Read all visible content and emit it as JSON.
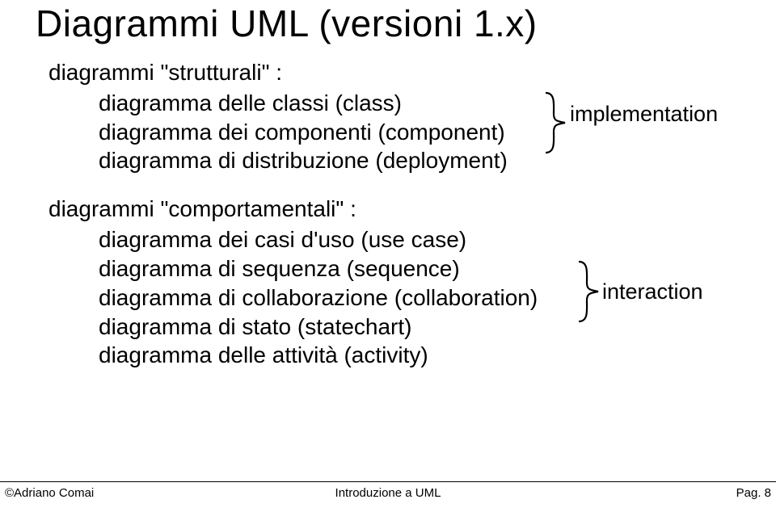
{
  "title": "Diagrammi UML (versioni 1.x)",
  "section1": {
    "head": "diagrammi \"strutturali\" :",
    "items": [
      "diagramma delle classi (class)",
      "diagramma dei componenti (component)",
      "diagramma di distribuzione (deployment)"
    ]
  },
  "annotation1": "implementation",
  "section2": {
    "head": "diagrammi \"comportamentali\" :",
    "items": [
      "diagramma dei casi d'uso (use case)",
      "diagramma di sequenza (sequence)",
      "diagramma di collaborazione (collaboration)",
      "diagramma di stato (statechart)",
      "diagramma delle attività (activity)"
    ]
  },
  "annotation2": "interaction",
  "footer": {
    "left": "©Adriano Comai",
    "center": "Introduzione a UML",
    "right": "Pag. 8"
  }
}
